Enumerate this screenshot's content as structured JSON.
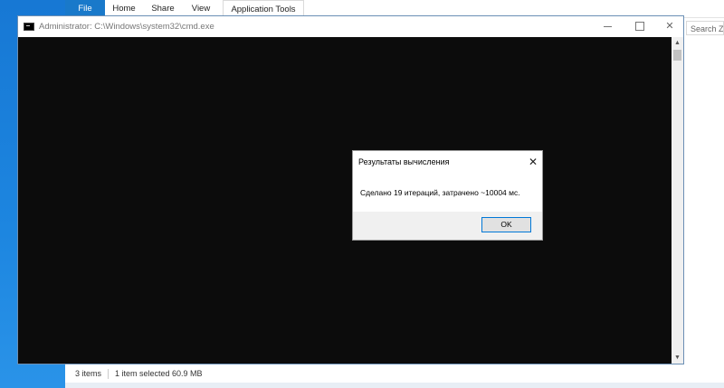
{
  "explorer": {
    "tabs": {
      "file": "File",
      "home": "Home",
      "share": "Share",
      "view": "View",
      "app_tools": "Application Tools"
    },
    "search_placeholder": "Search Zi",
    "status": {
      "items": "3 items",
      "selection": "1 item selected  60.9 MB"
    }
  },
  "cmd_window": {
    "title": "Administrator: C:\\Windows\\system32\\cmd.exe",
    "icon": "cmd-icon",
    "close_glyph": "✕"
  },
  "dialog": {
    "title": "Результаты вычисления",
    "message": "Сделано 19 итераций, затрачено ~10004 мс.",
    "ok_label": "OK",
    "close_glyph": "✕"
  },
  "colors": {
    "desktop": "#1a78d8",
    "file_tab": "#1979ca",
    "console_bg": "#0c0c0c",
    "ok_border": "#0078d7"
  }
}
